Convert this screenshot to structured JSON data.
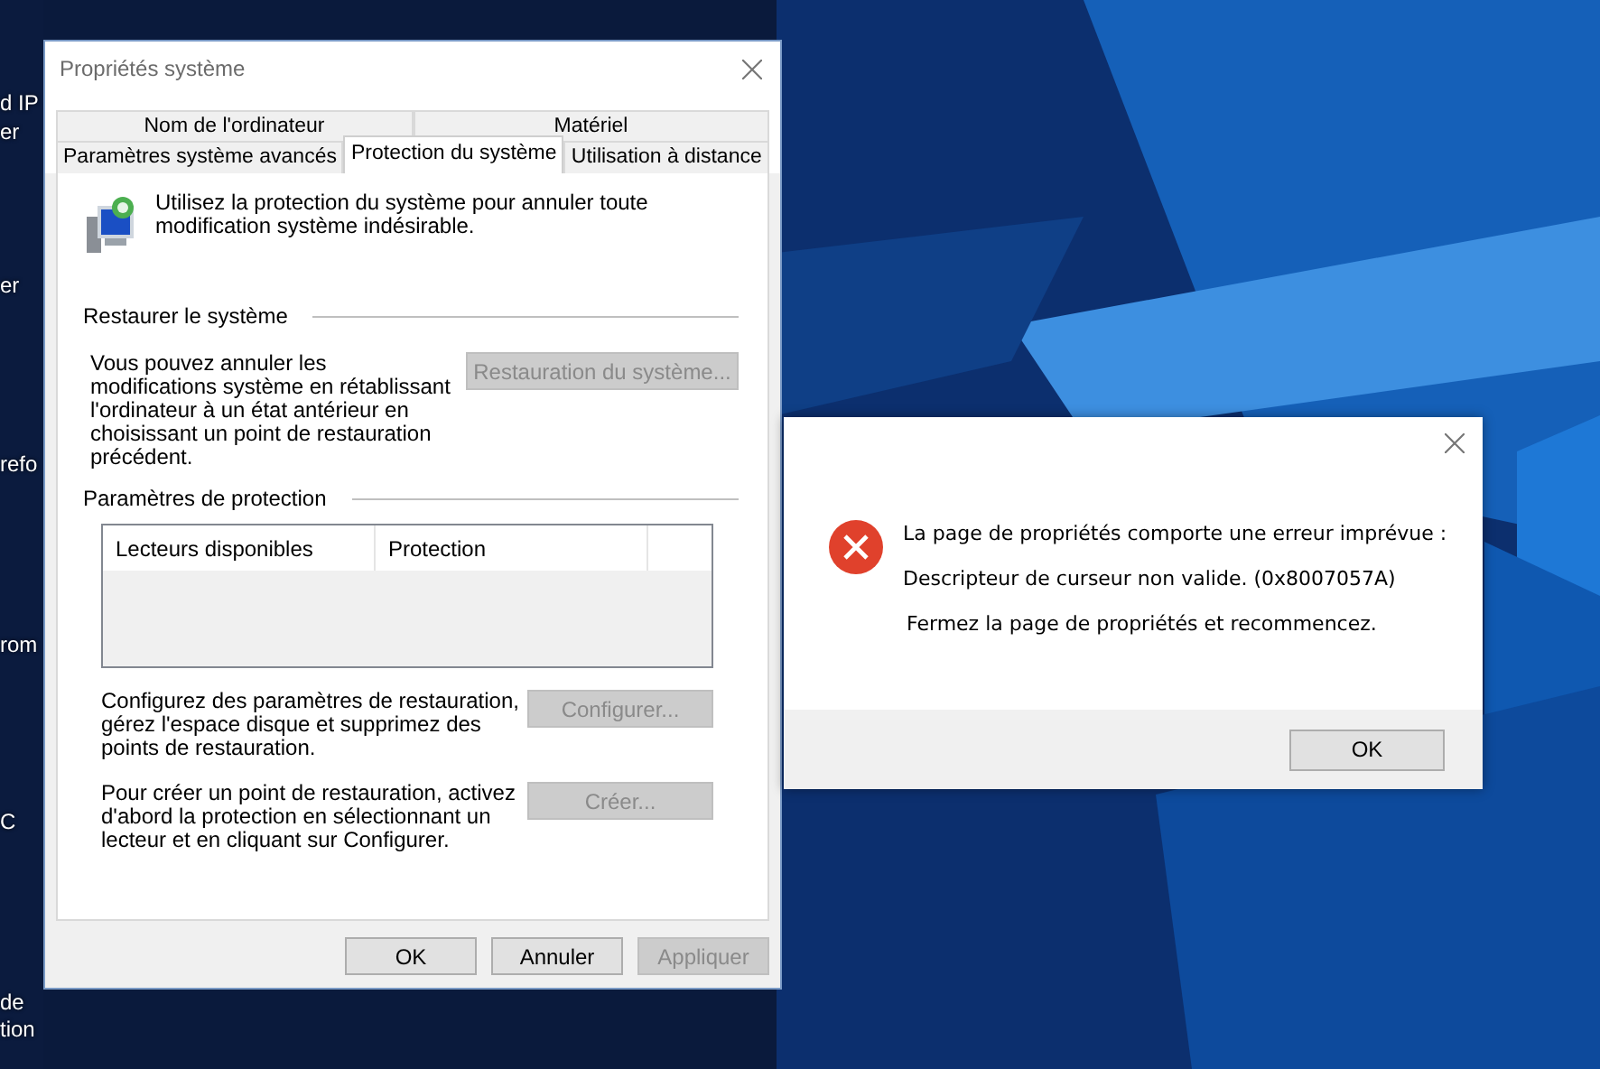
{
  "desktop_labels": [
    {
      "text": "d IP"
    },
    {
      "text": "er"
    },
    {
      "text": "er"
    },
    {
      "text": "refo"
    },
    {
      "text": "rom"
    },
    {
      "text": "C"
    },
    {
      "text": "de"
    },
    {
      "text": "tion"
    }
  ],
  "properties_window": {
    "title": "Propriétés système",
    "tab_rows": [
      [
        {
          "label": "Nom de l'ordinateur",
          "selected": false
        },
        {
          "label": "Matériel",
          "selected": false
        }
      ],
      [
        {
          "label": "Paramètres système avancés",
          "selected": false
        },
        {
          "label": "Protection du système",
          "selected": true
        },
        {
          "label": "Utilisation à distance",
          "selected": false
        }
      ]
    ],
    "intro": "Utilisez la protection du système pour annuler toute modification système indésirable.",
    "restore_section": {
      "heading": "Restaurer le système",
      "text": "Vous pouvez annuler les modifications système en rétablissant l'ordinateur à un état antérieur en choisissant un point de restauration précédent.",
      "button": {
        "label": "Restauration du système...",
        "disabled": true
      }
    },
    "protection_section": {
      "heading": "Paramètres de protection",
      "columns": [
        "Lecteurs disponibles",
        "Protection"
      ],
      "actions": [
        {
          "text": "Configurez des paramètres de restauration, gérez l'espace disque et supprimez des points de restauration.",
          "button": {
            "label": "Configurer...",
            "disabled": true
          }
        },
        {
          "text": "Pour créer un point de restauration, activez d'abord la protection en sélectionnant un lecteur et en cliquant sur Configurer.",
          "button": {
            "label": "Créer...",
            "disabled": true
          }
        }
      ]
    },
    "buttons": [
      {
        "label": "OK",
        "disabled": false
      },
      {
        "label": "Annuler",
        "disabled": false
      },
      {
        "label": "Appliquer",
        "disabled": true
      }
    ]
  },
  "error_dialog": {
    "messages": [
      "La page de propriétés comporte une erreur imprévue :",
      "Descripteur de curseur non valide. (0x8007057A)",
      "Fermez la page de propriétés et recommencez."
    ],
    "button": "OK"
  }
}
